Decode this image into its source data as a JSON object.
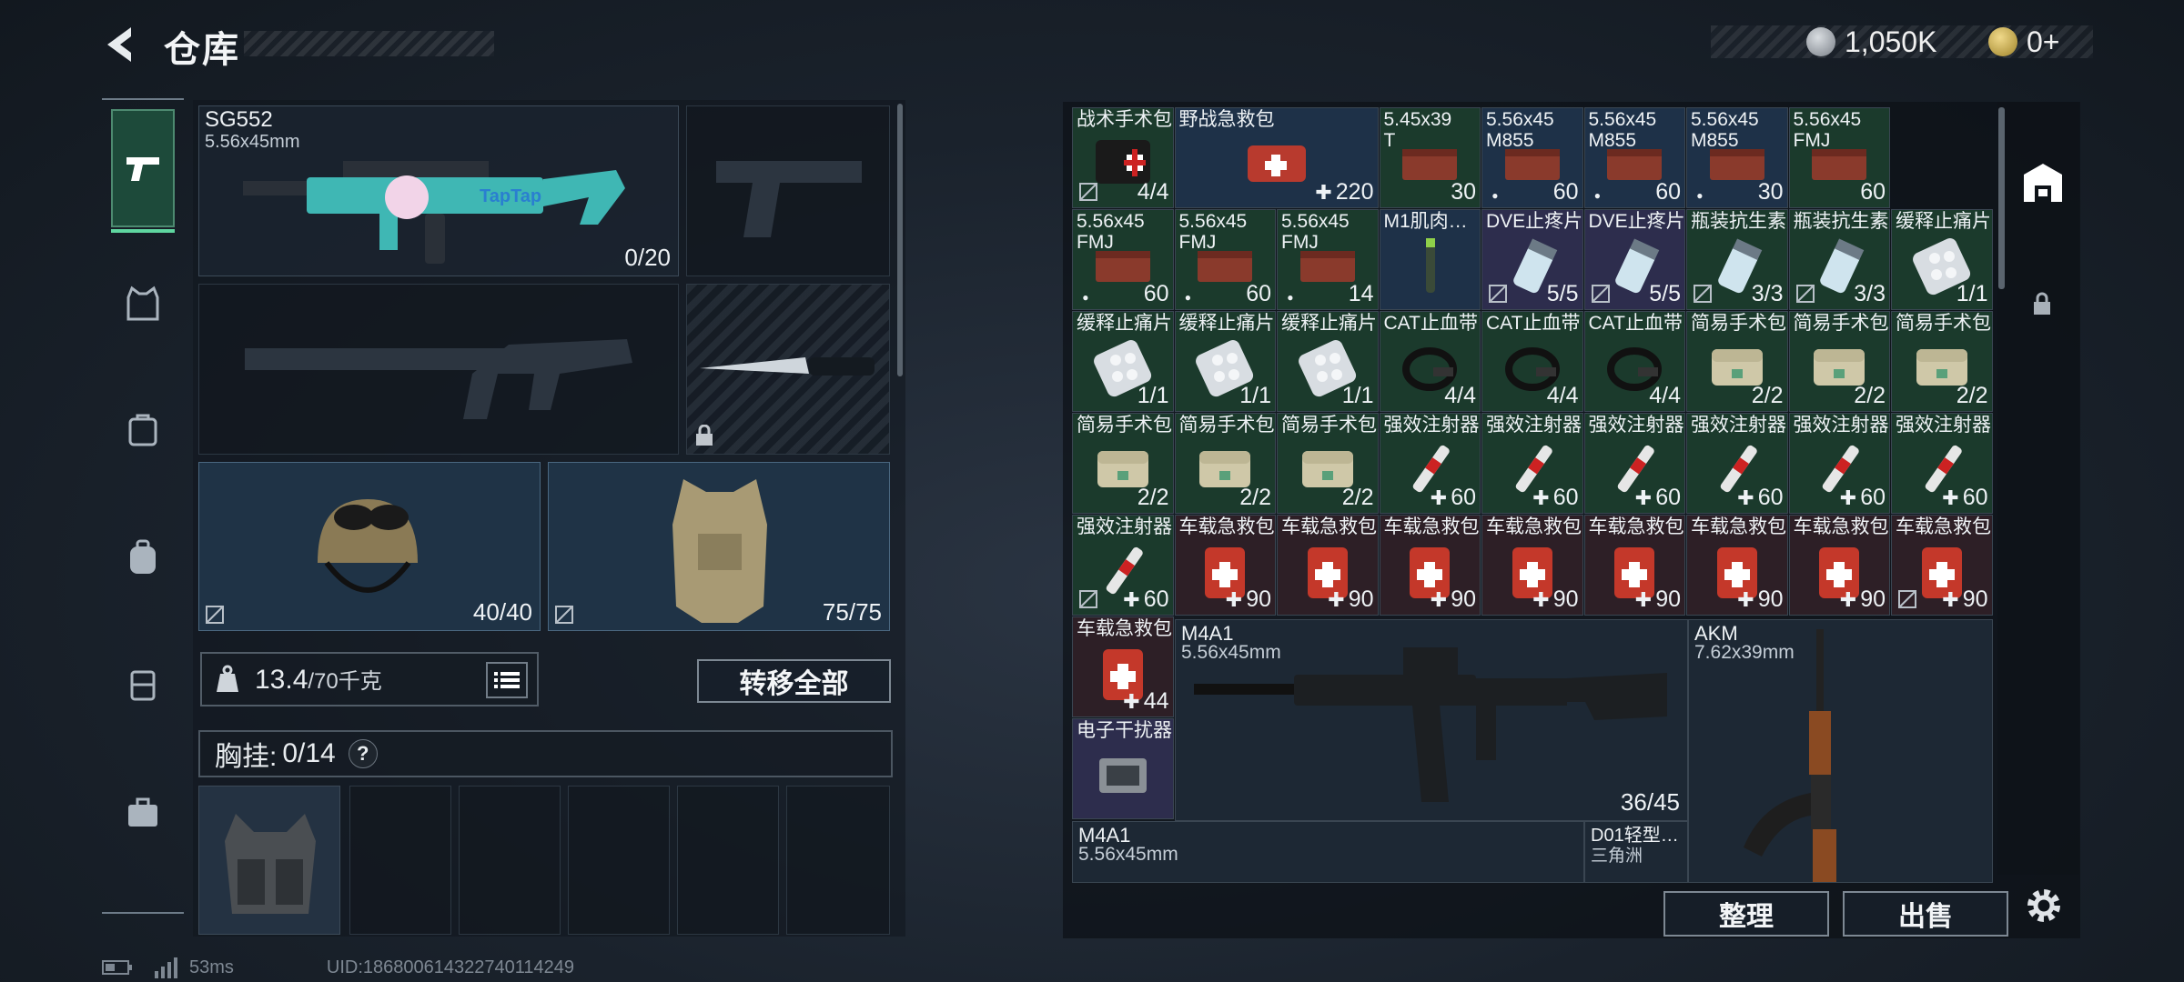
{
  "header": {
    "title": "仓库",
    "currency1": "1,050K",
    "currency2": "0+"
  },
  "sidebar": {
    "tabs": [
      "weapon",
      "armor",
      "backpack-alt",
      "backpack",
      "rig",
      "case"
    ]
  },
  "equipment": {
    "primary": {
      "name": "SG552",
      "caliber": "5.56x45mm",
      "count": "0/20"
    },
    "helmet": {
      "count": "40/40"
    },
    "armor": {
      "count": "75/75"
    },
    "weight": {
      "value": "13.4",
      "unit": "/70千克"
    },
    "transfer_all": "转移全部",
    "chest": {
      "label": "胸挂:",
      "value": "0/14",
      "help": "?"
    }
  },
  "grid": {
    "items": [
      {
        "name": "战术手术包",
        "count": "4/4",
        "bg": "g",
        "icon": "kit-icon",
        "nosell": true
      },
      {
        "name": "野战急救包",
        "count": "220",
        "bg": "b",
        "icon": "medkit-icon",
        "plus": true,
        "wide": true
      },
      {
        "name": "5.45x39\nT",
        "count": "30",
        "bg": "g",
        "icon": "ammo-box-icon"
      },
      {
        "name": "5.56x45\nM855",
        "count": "60",
        "bg": "b",
        "icon": "ammo-box-icon",
        "dot": true
      },
      {
        "name": "5.56x45\nM855",
        "count": "60",
        "bg": "b",
        "icon": "ammo-box-icon",
        "dot": true
      },
      {
        "name": "5.56x45\nM855",
        "count": "30",
        "bg": "b",
        "icon": "ammo-box-icon",
        "dot": true
      },
      {
        "name": "5.56x45\nFMJ",
        "count": "60",
        "bg": "g",
        "icon": "ammo-box-icon"
      },
      {
        "name": "5.56x45\nFMJ",
        "count": "60",
        "bg": "g",
        "icon": "ammo-box-icon",
        "dot": true
      },
      {
        "name": "5.56x45\nFMJ",
        "count": "60",
        "bg": "g",
        "icon": "ammo-box-icon",
        "dot": true
      },
      {
        "name": "5.56x45\nFMJ",
        "count": "14",
        "bg": "g",
        "icon": "ammo-box-icon",
        "dot": true
      },
      {
        "name": "M1肌肉…",
        "count": "",
        "bg": "b",
        "icon": "injector-icon"
      },
      {
        "name": "DVE止疼片",
        "count": "5/5",
        "bg": "p",
        "icon": "pill-bottle-icon",
        "nosell": true
      },
      {
        "name": "DVE止疼片",
        "count": "5/5",
        "bg": "p",
        "icon": "pill-bottle-icon",
        "nosell": true
      },
      {
        "name": "瓶装抗生素",
        "count": "3/3",
        "bg": "g",
        "icon": "pill-bottle-icon",
        "nosell": true
      },
      {
        "name": "瓶装抗生素",
        "count": "3/3",
        "bg": "g",
        "icon": "pill-bottle-icon",
        "nosell": true
      },
      {
        "name": "缓释止痛片",
        "count": "1/1",
        "bg": "g",
        "icon": "blister-icon"
      },
      {
        "name": "缓释止痛片",
        "count": "1/1",
        "bg": "g",
        "icon": "blister-icon"
      },
      {
        "name": "缓释止痛片",
        "count": "1/1",
        "bg": "g",
        "icon": "blister-icon"
      },
      {
        "name": "缓释止痛片",
        "count": "1/1",
        "bg": "g",
        "icon": "blister-icon"
      },
      {
        "name": "CAT止血带",
        "count": "4/4",
        "bg": "g",
        "icon": "tourniquet-icon"
      },
      {
        "name": "CAT止血带",
        "count": "4/4",
        "bg": "g",
        "icon": "tourniquet-icon"
      },
      {
        "name": "CAT止血带",
        "count": "4/4",
        "bg": "g",
        "icon": "tourniquet-icon"
      },
      {
        "name": "简易手术包",
        "count": "2/2",
        "bg": "g",
        "icon": "pouch-icon"
      },
      {
        "name": "简易手术包",
        "count": "2/2",
        "bg": "g",
        "icon": "pouch-icon"
      },
      {
        "name": "简易手术包",
        "count": "2/2",
        "bg": "g",
        "icon": "pouch-icon"
      },
      {
        "name": "简易手术包",
        "count": "2/2",
        "bg": "g",
        "icon": "pouch-icon"
      },
      {
        "name": "简易手术包",
        "count": "2/2",
        "bg": "g",
        "icon": "pouch-icon"
      },
      {
        "name": "简易手术包",
        "count": "2/2",
        "bg": "g",
        "icon": "pouch-icon"
      },
      {
        "name": "强效注射器",
        "count": "60",
        "bg": "g",
        "icon": "syringe-icon",
        "plus": true
      },
      {
        "name": "强效注射器",
        "count": "60",
        "bg": "g",
        "icon": "syringe-icon",
        "plus": true
      },
      {
        "name": "强效注射器",
        "count": "60",
        "bg": "g",
        "icon": "syringe-icon",
        "plus": true
      },
      {
        "name": "强效注射器",
        "count": "60",
        "bg": "g",
        "icon": "syringe-icon",
        "plus": true
      },
      {
        "name": "强效注射器",
        "count": "60",
        "bg": "g",
        "icon": "syringe-icon",
        "plus": true
      },
      {
        "name": "强效注射器",
        "count": "60",
        "bg": "g",
        "icon": "syringe-icon",
        "plus": true
      },
      {
        "name": "强效注射器",
        "count": "60",
        "bg": "g",
        "icon": "syringe-icon",
        "plus": true,
        "nosell": true
      },
      {
        "name": "车载急救包",
        "count": "90",
        "bg": "r",
        "icon": "car-kit-icon",
        "plus": true
      },
      {
        "name": "车载急救包",
        "count": "90",
        "bg": "r",
        "icon": "car-kit-icon",
        "plus": true
      },
      {
        "name": "车载急救包",
        "count": "90",
        "bg": "r",
        "icon": "car-kit-icon",
        "plus": true
      },
      {
        "name": "车载急救包",
        "count": "90",
        "bg": "r",
        "icon": "car-kit-icon",
        "plus": true
      },
      {
        "name": "车载急救包",
        "count": "90",
        "bg": "r",
        "icon": "car-kit-icon",
        "plus": true
      },
      {
        "name": "车载急救包",
        "count": "90",
        "bg": "r",
        "icon": "car-kit-icon",
        "plus": true
      },
      {
        "name": "车载急救包",
        "count": "90",
        "bg": "r",
        "icon": "car-kit-icon",
        "plus": true
      },
      {
        "name": "车载急救包",
        "count": "90",
        "bg": "r",
        "icon": "car-kit-icon",
        "plus": true,
        "nosell": true
      },
      {
        "name": "车载急救包",
        "count": "44",
        "bg": "r",
        "icon": "car-kit-icon",
        "plus": true
      },
      {
        "name": "电子干扰器",
        "count": "",
        "bg": "p",
        "icon": "jammer-icon"
      }
    ],
    "big": {
      "m4a1": {
        "name": "M4A1",
        "caliber": "5.56x45mm",
        "count": "36/45"
      },
      "akm": {
        "name": "AKM",
        "caliber": "7.62x39mm"
      },
      "m4a1b": {
        "name": "M4A1",
        "caliber": "5.56x45mm"
      },
      "d01": {
        "name": "D01轻型…",
        "sub": "三角洲"
      }
    }
  },
  "actions": {
    "sort": "整理",
    "sell": "出售"
  },
  "status": {
    "ping": "53ms",
    "uid": "UID:1868006143227401142​49"
  },
  "colors": {
    "accent": "#5fd6a0",
    "green_cell": "#1b3a2c",
    "blue_cell": "#1e3148"
  }
}
